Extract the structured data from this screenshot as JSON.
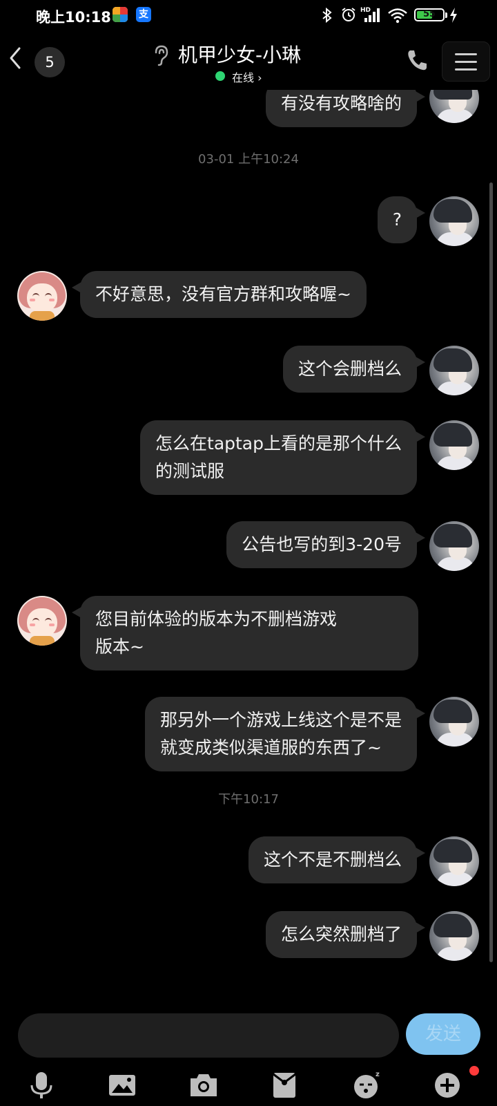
{
  "status_bar": {
    "time": "晚上10:18",
    "battery": "55",
    "network_label": "HD"
  },
  "header": {
    "unread_count": "5",
    "title": "机甲少女-小琳",
    "status": "在线",
    "status_chevron": "›"
  },
  "messages": {
    "top_partial": "有没有攻略啥的",
    "ts1": "03-01 上午10:24",
    "m1": "?",
    "m2": "不好意思，没有官方群和攻略喔~",
    "m3": "这个会删档么",
    "m4_line1": "怎么在taptap上看的是那个什么",
    "m4_line2": "的测试服",
    "m5": "公告也写的到3-20号",
    "m6_line1": "您目前体验的版本为不删档游戏",
    "m6_line2": "版本~",
    "m7_line1": "那另外一个游戏上线这个是不是",
    "m7_line2": "就变成类似渠道服的东西了~",
    "ts2": "下午10:17",
    "m8": "这个不是不删档么",
    "m9": "怎么突然删档了"
  },
  "composer": {
    "input_value": "",
    "send_label": "发送"
  },
  "colors": {
    "background": "#000000",
    "bubble": "#2b2b2b",
    "online": "#2ed573",
    "send": "#7fc3f0"
  },
  "icons": [
    "back-chevron-icon",
    "ear-icon",
    "phone-icon",
    "menu-icon",
    "microphone-icon",
    "image-icon",
    "camera-icon",
    "red-packet-icon",
    "emoji-icon",
    "plus-icon"
  ]
}
